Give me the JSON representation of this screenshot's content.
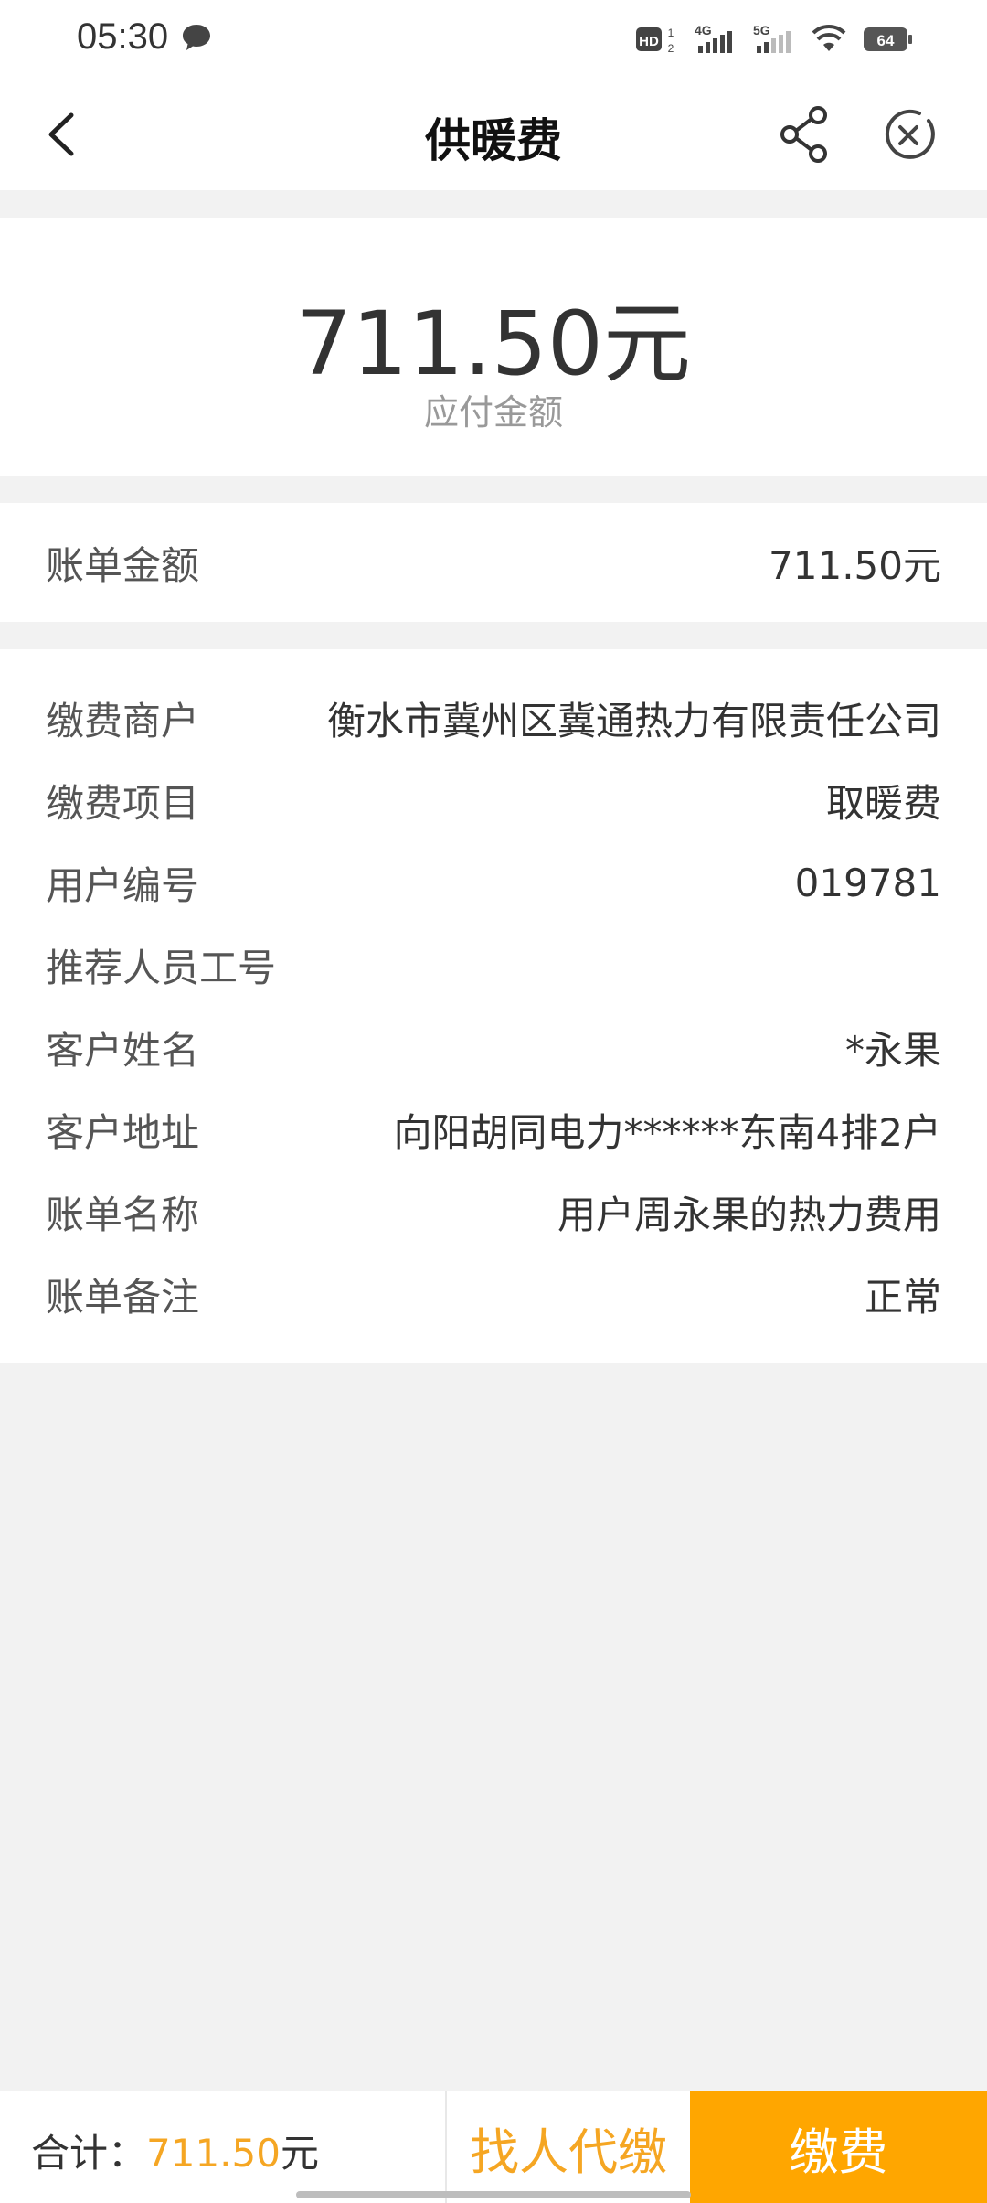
{
  "status_bar": {
    "time": "05:30",
    "battery": "64",
    "network_labels": [
      "HD",
      "4G",
      "5G"
    ]
  },
  "navbar": {
    "title": "供暖费",
    "icons": [
      "chevron-left-icon",
      "share-icon",
      "close-circle-icon"
    ]
  },
  "amount": {
    "value": "711.50元",
    "label": "应付金额"
  },
  "bill": {
    "label": "账单金额",
    "value": "711.50元"
  },
  "details": [
    {
      "label": "缴费商户",
      "value": "衡水市冀州区冀通热力有限责任公司"
    },
    {
      "label": "缴费项目",
      "value": "取暖费"
    },
    {
      "label": "用户编号",
      "value": "019781"
    },
    {
      "label": "推荐人员工号",
      "value": ""
    },
    {
      "label": "客户姓名",
      "value": "*永果"
    },
    {
      "label": "客户地址",
      "value": "向阳胡同电力******东南4排2户"
    },
    {
      "label": "账单名称",
      "value": "用户周永果的热力费用"
    },
    {
      "label": "账单备注",
      "value": "正常"
    }
  ],
  "bottom": {
    "total_label": "合计：",
    "total_value": "711.50",
    "total_unit": "元",
    "proxy_pay_label": "找人代缴",
    "pay_label": "缴费"
  },
  "colors": {
    "accent": "#ffa600",
    "accent_text": "#f5a623",
    "background": "#f2f2f2"
  }
}
